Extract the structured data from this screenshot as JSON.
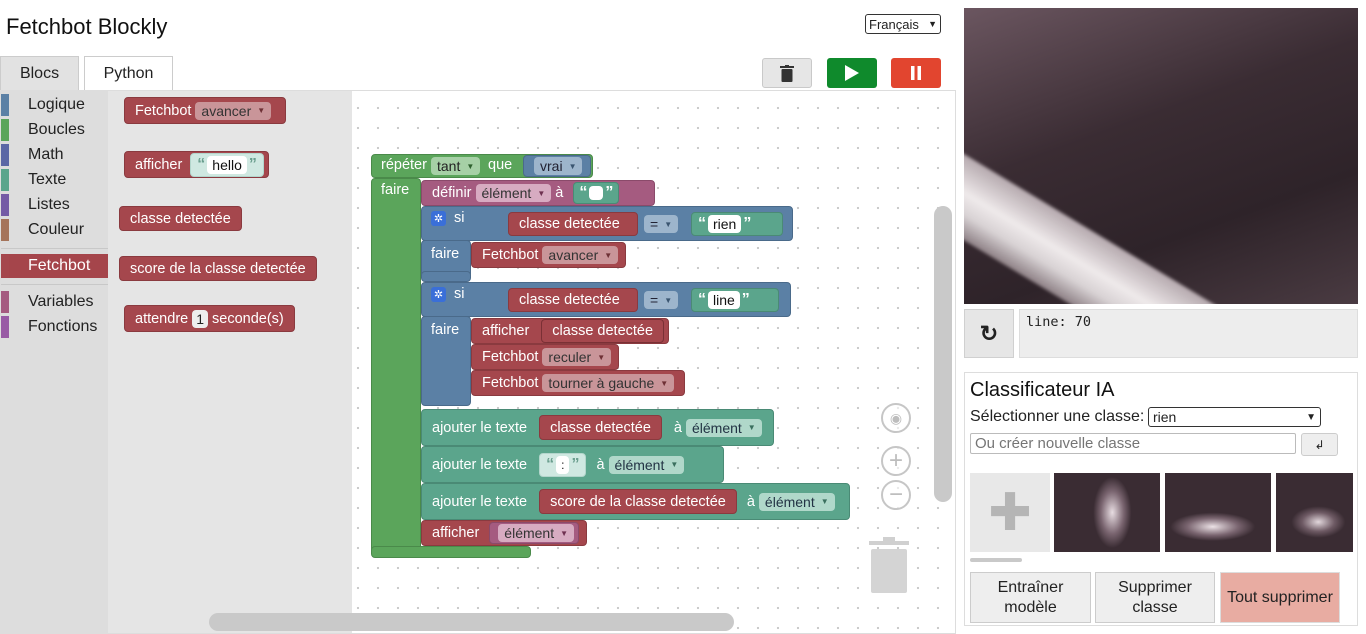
{
  "app": {
    "title": "Fetchbot Blockly",
    "language": "Français"
  },
  "tabs": [
    {
      "label": "Blocs",
      "active": true
    },
    {
      "label": "Python",
      "active": false
    }
  ],
  "toolbar": {
    "trash_icon": "trash-icon",
    "run_icon": "play-icon",
    "stop_icon": "pause-icon",
    "run_color": "#0f8a2c",
    "stop_color": "#e2452f"
  },
  "toolbox": {
    "categories": [
      {
        "label": "Logique",
        "color": "#5b80a5"
      },
      {
        "label": "Boucles",
        "color": "#5ba55b"
      },
      {
        "label": "Math",
        "color": "#5b67a5"
      },
      {
        "label": "Texte",
        "color": "#5ba58c"
      },
      {
        "label": "Listes",
        "color": "#745ba5"
      },
      {
        "label": "Couleur",
        "color": "#a5745b"
      },
      {
        "label": "Fetchbot",
        "color": "#a5474d"
      },
      {
        "label": "Variables",
        "color": "#a55b80"
      },
      {
        "label": "Fonctions",
        "color": "#995ba5"
      }
    ]
  },
  "flyout": {
    "b1": {
      "label": "Fetchbot",
      "dropdown": "avancer"
    },
    "b2": {
      "label": "afficher",
      "string": "hello"
    },
    "b3": {
      "label": "classe detectée"
    },
    "b4": {
      "label": "score de la classe detectée"
    },
    "b5": {
      "label": "attendre",
      "number": "1",
      "suffix": "seconde(s)"
    }
  },
  "program": {
    "repeat": {
      "label": "répéter",
      "mode": "tant",
      "que": "que",
      "cond": "vrai",
      "do": "faire"
    },
    "set": {
      "label": "définir",
      "var": "élément",
      "to": "à"
    },
    "if1": {
      "label": "si",
      "lhs": "classe detectée",
      "op": "=",
      "rhs": "rien",
      "do": "faire",
      "cmd_label": "Fetchbot",
      "cmd": "avancer"
    },
    "if2": {
      "label": "si",
      "lhs": "classe detectée",
      "op": "=",
      "rhs": "line",
      "do": "faire",
      "print_label": "afficher",
      "print_value": "classe detectée",
      "cmd1_label": "Fetchbot",
      "cmd1": "reculer",
      "cmd2_label": "Fetchbot",
      "cmd2": "tourner à gauche"
    },
    "append1": {
      "label": "ajouter le texte",
      "value": "classe detectée",
      "to": "à",
      "var": "élément"
    },
    "append2": {
      "label": "ajouter le texte",
      "value": ":",
      "to": "à",
      "var": "élément"
    },
    "append3": {
      "label": "ajouter le texte",
      "value": "score de la classe detectée",
      "to": "à",
      "var": "élément"
    },
    "print": {
      "label": "afficher",
      "var": "élément"
    }
  },
  "camera": {
    "refresh_icon": "refresh-icon",
    "prediction": "line: 70"
  },
  "classifier": {
    "title": "Classificateur IA",
    "select_label": "Sélectionner une classe:",
    "selected_class": "rien",
    "new_class_placeholder": "Ou créer nouvelle classe",
    "enter_label": "↲",
    "add_icon": "plus-icon",
    "train_label": "Entraîner modèle",
    "delete_class_label": "Supprimer classe",
    "delete_all_label": "Tout supprimer"
  }
}
